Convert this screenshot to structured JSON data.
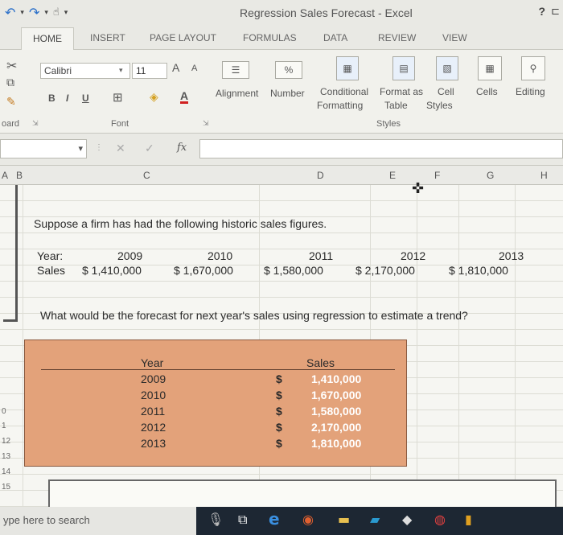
{
  "window": {
    "title": "Regression Sales Forecast - Excel",
    "help": "?"
  },
  "tabs": [
    "HOME",
    "INSERT",
    "PAGE LAYOUT",
    "FORMULAS",
    "DATA",
    "REVIEW",
    "VIEW"
  ],
  "ribbon": {
    "font_name": "Calibri",
    "font_size": "11",
    "bold": "B",
    "italic": "I",
    "underline": "U",
    "grow_font": "A",
    "shrink_font": "A",
    "font_color": "A",
    "alignment": "Alignment",
    "number": "Number",
    "percent": "%",
    "conditional_formatting": [
      "Conditional",
      "Formatting"
    ],
    "format_as_table": [
      "Format as",
      "Table"
    ],
    "cell_styles": [
      "Cell",
      "Styles"
    ],
    "cells": "Cells",
    "editing": "Editing",
    "group_clipboard": "oard",
    "group_font": "Font",
    "group_styles": "Styles"
  },
  "formula_bar": {
    "fx": "fx",
    "cancel": "✕",
    "enter": "✓"
  },
  "columns": [
    "A",
    "B",
    "C",
    "D",
    "E",
    "F",
    "G",
    "H"
  ],
  "rows": [
    "0",
    "1",
    "12",
    "13",
    "14",
    "15"
  ],
  "sheet": {
    "intro": "Suppose a firm has had the following historic sales figures.",
    "year_label": "Year:",
    "sales_label": "Sales",
    "years": [
      "2009",
      "2010",
      "2011",
      "2012",
      "2013"
    ],
    "sales": [
      "$ 1,410,000",
      "$ 1,670,000",
      "$ 1,580,000",
      "$ 2,170,000",
      "$ 1,810,000"
    ],
    "question": "What would be the forecast for next year's sales using regression to estimate a trend?"
  },
  "table": {
    "year_header": "Year",
    "sales_header": "Sales",
    "years": [
      "2009",
      "2010",
      "2011",
      "2012",
      "2013"
    ],
    "dollar": "$",
    "sales": [
      "1,410,000",
      "1,670,000",
      "1,580,000",
      "2,170,000",
      "1,810,000"
    ]
  },
  "taskbar": {
    "search": "ype here to search"
  }
}
